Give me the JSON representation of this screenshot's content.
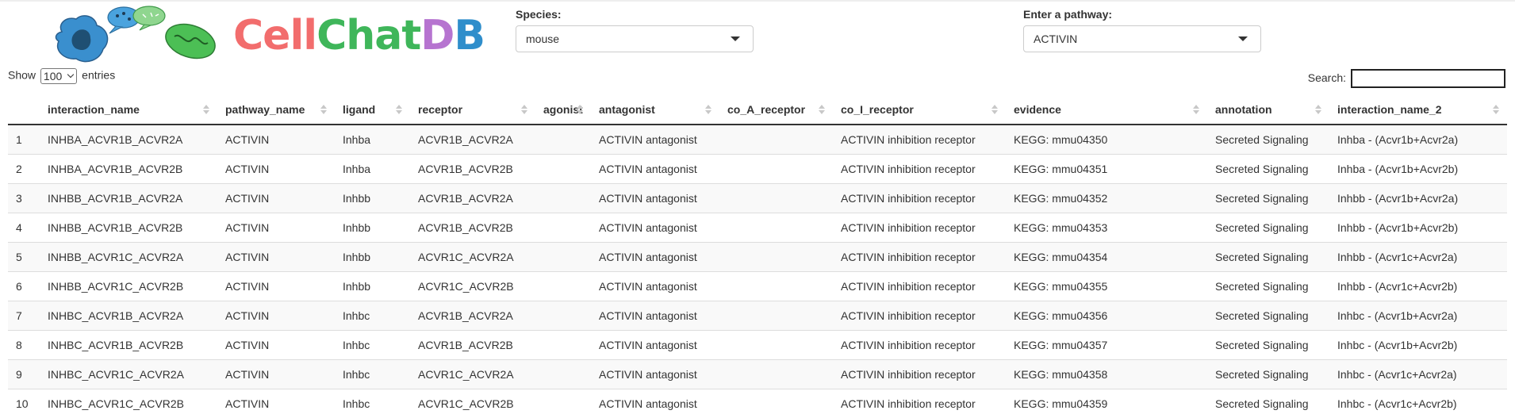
{
  "logo": {
    "text_parts": [
      "C",
      "ell",
      "C",
      "hat",
      "D",
      "B"
    ]
  },
  "species": {
    "label": "Species:",
    "value": "mouse"
  },
  "pathway": {
    "label": "Enter a pathway:",
    "value": "ACTIVIN"
  },
  "length": {
    "show": "Show",
    "value": "100",
    "entries": "entries"
  },
  "search": {
    "label": "Search:",
    "value": ""
  },
  "table": {
    "columns": [
      "",
      "interaction_name",
      "pathway_name",
      "ligand",
      "receptor",
      "agonist",
      "antagonist",
      "co_A_receptor",
      "co_I_receptor",
      "evidence",
      "annotation",
      "interaction_name_2"
    ],
    "rows": [
      [
        "1",
        "INHBA_ACVR1B_ACVR2A",
        "ACTIVIN",
        "Inhba",
        "ACVR1B_ACVR2A",
        "",
        "ACTIVIN antagonist",
        "",
        "ACTIVIN inhibition receptor",
        "KEGG: mmu04350",
        "Secreted Signaling",
        "Inhba - (Acvr1b+Acvr2a)"
      ],
      [
        "2",
        "INHBA_ACVR1B_ACVR2B",
        "ACTIVIN",
        "Inhba",
        "ACVR1B_ACVR2B",
        "",
        "ACTIVIN antagonist",
        "",
        "ACTIVIN inhibition receptor",
        "KEGG: mmu04351",
        "Secreted Signaling",
        "Inhba - (Acvr1b+Acvr2b)"
      ],
      [
        "3",
        "INHBB_ACVR1B_ACVR2A",
        "ACTIVIN",
        "Inhbb",
        "ACVR1B_ACVR2A",
        "",
        "ACTIVIN antagonist",
        "",
        "ACTIVIN inhibition receptor",
        "KEGG: mmu04352",
        "Secreted Signaling",
        "Inhbb - (Acvr1b+Acvr2a)"
      ],
      [
        "4",
        "INHBB_ACVR1B_ACVR2B",
        "ACTIVIN",
        "Inhbb",
        "ACVR1B_ACVR2B",
        "",
        "ACTIVIN antagonist",
        "",
        "ACTIVIN inhibition receptor",
        "KEGG: mmu04353",
        "Secreted Signaling",
        "Inhbb - (Acvr1b+Acvr2b)"
      ],
      [
        "5",
        "INHBB_ACVR1C_ACVR2A",
        "ACTIVIN",
        "Inhbb",
        "ACVR1C_ACVR2A",
        "",
        "ACTIVIN antagonist",
        "",
        "ACTIVIN inhibition receptor",
        "KEGG: mmu04354",
        "Secreted Signaling",
        "Inhbb - (Acvr1c+Acvr2a)"
      ],
      [
        "6",
        "INHBB_ACVR1C_ACVR2B",
        "ACTIVIN",
        "Inhbb",
        "ACVR1C_ACVR2B",
        "",
        "ACTIVIN antagonist",
        "",
        "ACTIVIN inhibition receptor",
        "KEGG: mmu04355",
        "Secreted Signaling",
        "Inhbb - (Acvr1c+Acvr2b)"
      ],
      [
        "7",
        "INHBC_ACVR1B_ACVR2A",
        "ACTIVIN",
        "Inhbc",
        "ACVR1B_ACVR2A",
        "",
        "ACTIVIN antagonist",
        "",
        "ACTIVIN inhibition receptor",
        "KEGG: mmu04356",
        "Secreted Signaling",
        "Inhbc - (Acvr1b+Acvr2a)"
      ],
      [
        "8",
        "INHBC_ACVR1B_ACVR2B",
        "ACTIVIN",
        "Inhbc",
        "ACVR1B_ACVR2B",
        "",
        "ACTIVIN antagonist",
        "",
        "ACTIVIN inhibition receptor",
        "KEGG: mmu04357",
        "Secreted Signaling",
        "Inhbc - (Acvr1b+Acvr2b)"
      ],
      [
        "9",
        "INHBC_ACVR1C_ACVR2A",
        "ACTIVIN",
        "Inhbc",
        "ACVR1C_ACVR2A",
        "",
        "ACTIVIN antagonist",
        "",
        "ACTIVIN inhibition receptor",
        "KEGG: mmu04358",
        "Secreted Signaling",
        "Inhbc - (Acvr1c+Acvr2a)"
      ],
      [
        "10",
        "INHBC_ACVR1C_ACVR2B",
        "ACTIVIN",
        "Inhbc",
        "ACVR1C_ACVR2B",
        "",
        "ACTIVIN antagonist",
        "",
        "ACTIVIN inhibition receptor",
        "KEGG: mmu04359",
        "Secreted Signaling",
        "Inhbc - (Acvr1c+Acvr2b)"
      ]
    ]
  },
  "colors": {
    "logo_red": "#f26d6d",
    "logo_orange": "#f59b3a",
    "logo_green": "#3fb65a",
    "logo_blue": "#2f8ecb",
    "logo_purple": "#b674d0",
    "row_stripe": "#f9f9f9"
  }
}
